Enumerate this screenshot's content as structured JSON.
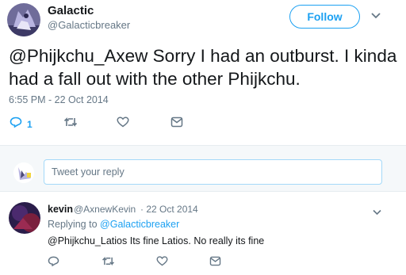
{
  "tweet": {
    "name": "Galactic",
    "handle": "@Galacticbreaker",
    "follow_label": "Follow",
    "text": "@Phijkchu_Axew Sorry I had an outburst.  I kinda had a fall out with the other Phijkchu.",
    "timestamp": "6:55 PM - 22 Oct 2014",
    "reply_count": "1",
    "icons": [
      "reply-icon",
      "retweet-icon",
      "like-icon",
      "direct-message-icon",
      "chevron-down-icon"
    ]
  },
  "composer": {
    "placeholder": "Tweet your reply"
  },
  "reply": {
    "name": "kevin",
    "handle": "@AxnewKevin",
    "date": "· 22 Oct 2014",
    "replying_prefix": "Replying to",
    "replying_to": "@Galacticbreaker",
    "text": "@Phijkchu_Latios Its fine Latios. No really its fine"
  },
  "colors": {
    "accent": "#1da1f2",
    "muted": "#657786",
    "text": "#14171a",
    "divider": "#e6ecf0"
  }
}
